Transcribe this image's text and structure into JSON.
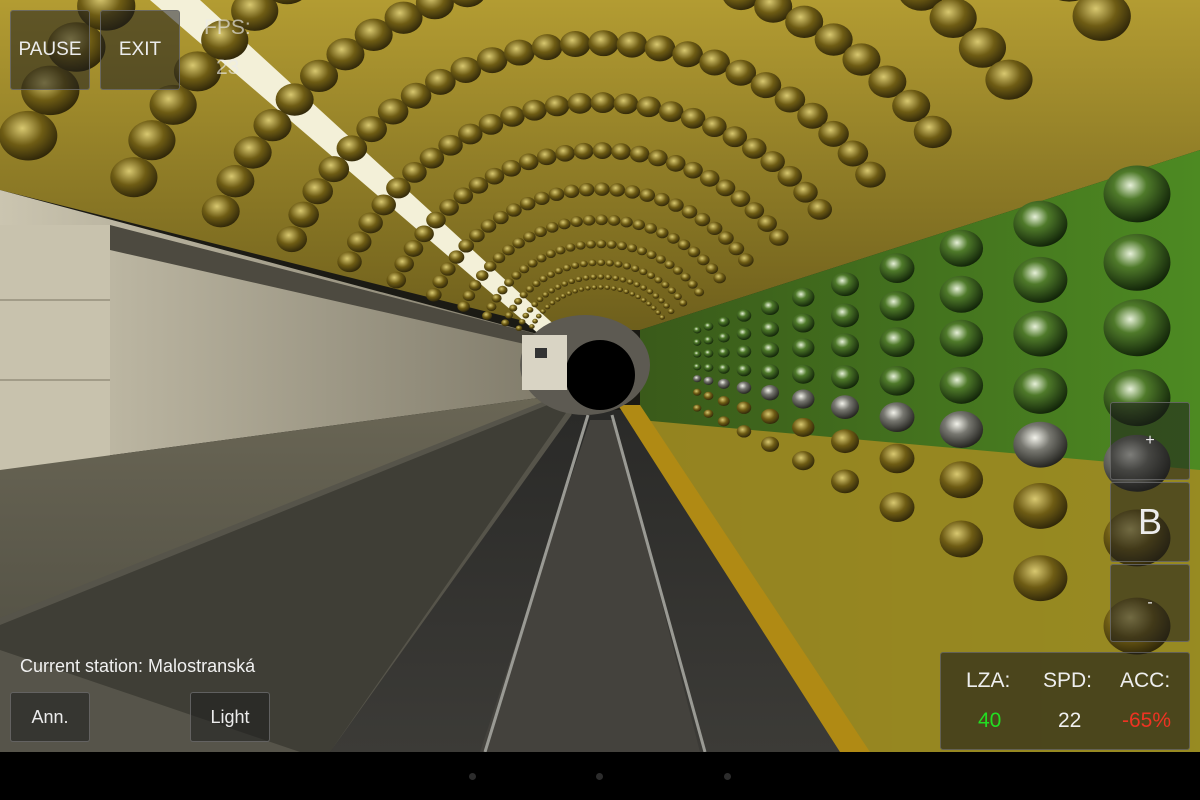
{
  "controls": {
    "pause_label": "PAUSE",
    "exit_label": "EXIT",
    "announce_label": "Ann.",
    "light_label": "Light",
    "throttle_up_label": "+",
    "brake_label": "B",
    "throttle_down_label": "-"
  },
  "fps": {
    "label": "FPS:",
    "value": "23"
  },
  "station": {
    "text": "Current station: Malostranská"
  },
  "hud": {
    "lza_label": "LZA:",
    "lza_value": "40",
    "spd_label": "SPD:",
    "spd_value": "22",
    "acc_label": "ACC:",
    "acc_value": "-65%"
  },
  "colors": {
    "lza": "#22dd22",
    "spd": "#f0f0f0",
    "acc": "#ee3322",
    "wall_gold": "#b09a2a",
    "wall_green": "#3d7f1e",
    "wall_silver": "#9a9a90"
  },
  "nav_icons": [
    "back-icon",
    "home-icon",
    "recent-apps-icon"
  ]
}
